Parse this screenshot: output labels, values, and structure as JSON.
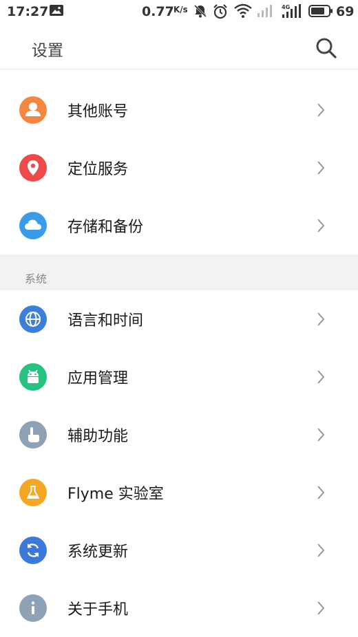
{
  "status_bar": {
    "time": "17:27",
    "net_speed": "0.77",
    "net_speed_unit": "K/s",
    "battery": "69"
  },
  "header": {
    "title": "设置",
    "search_icon": "search-icon"
  },
  "accounts": [
    {
      "label": "其他账号",
      "icon": "person-icon",
      "color": "#f4873f"
    },
    {
      "label": "定位服务",
      "icon": "location-pin-icon",
      "color": "#ef4a4a"
    },
    {
      "label": "存储和备份",
      "icon": "cloud-icon",
      "color": "#3a9be8"
    }
  ],
  "system": {
    "section_label": "系统",
    "items": [
      {
        "label": "语言和时间",
        "icon": "globe-icon",
        "color": "#3d7ed8"
      },
      {
        "label": "应用管理",
        "icon": "android-icon",
        "color": "#26c281"
      },
      {
        "label": "辅助功能",
        "icon": "hand-pointer-icon",
        "color": "#8fa1b4"
      },
      {
        "label": "Flyme 实验室",
        "icon": "flask-icon",
        "color": "#f5a623"
      },
      {
        "label": "系统更新",
        "icon": "refresh-icon",
        "color": "#3b78d8"
      },
      {
        "label": "关于手机",
        "icon": "info-icon",
        "color": "#8fa1b4"
      }
    ]
  }
}
